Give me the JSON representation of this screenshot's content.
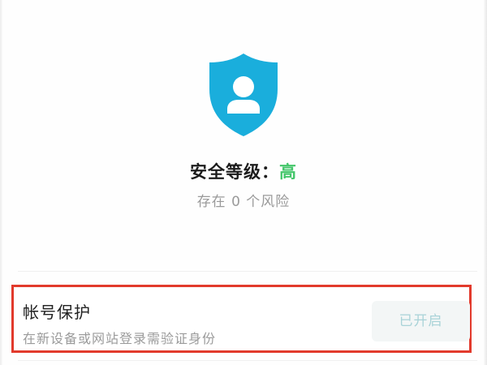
{
  "security": {
    "shield_icon": "user-shield-icon",
    "level_label": "安全等级：",
    "level_value": "高",
    "risk_text": "存在 0 个风险"
  },
  "account_protection": {
    "title": "帐号保护",
    "description": "在新设备或网站登录需验证身份",
    "status_label": "已开启"
  },
  "colors": {
    "shield": "#1aaedc",
    "level_high": "#43c66a",
    "highlight_border": "#e23a2c",
    "status_text": "#a9d3d8"
  }
}
